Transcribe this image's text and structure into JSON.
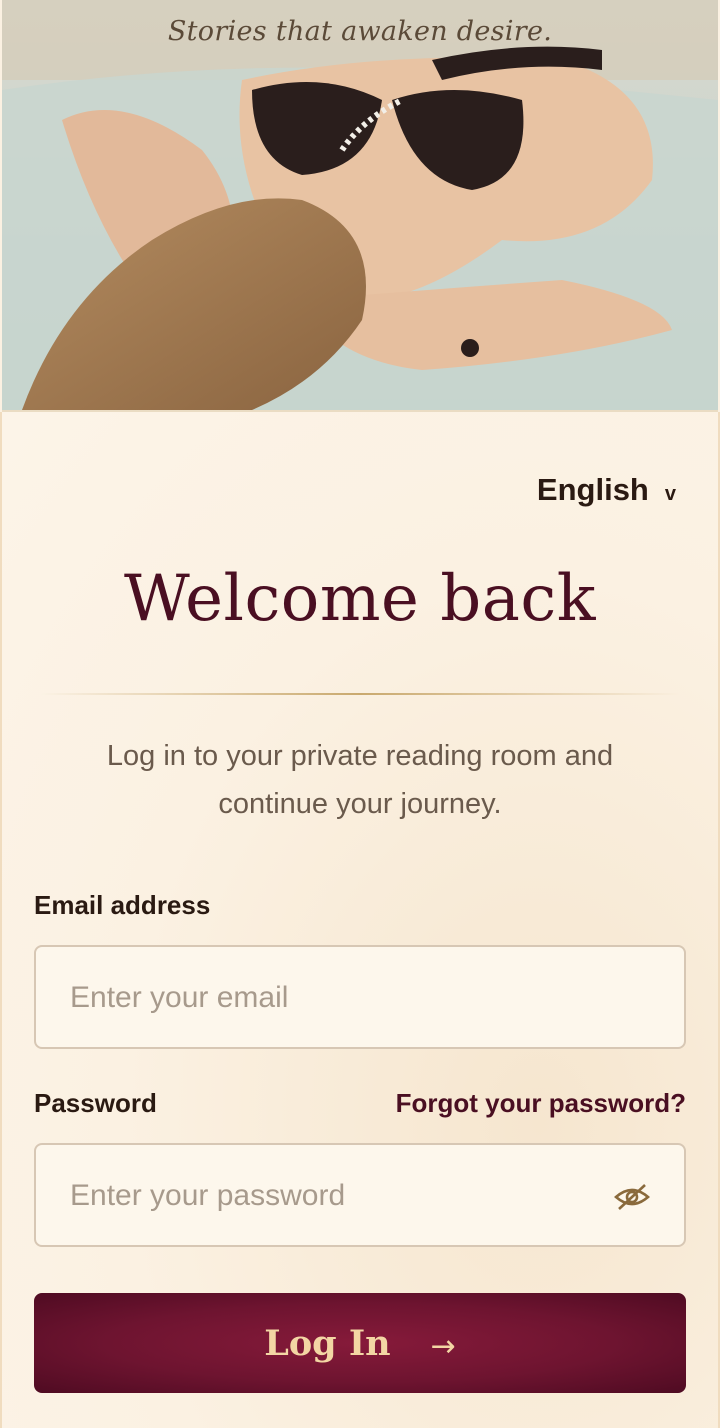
{
  "hero": {
    "tagline": "Stories that awaken desire."
  },
  "language": {
    "selected": "English",
    "chevron": "v"
  },
  "heading": "Welcome back",
  "subtitle": "Log in to your private reading room and continue your journey.",
  "email": {
    "label": "Email address",
    "placeholder": "Enter your email",
    "value": ""
  },
  "password": {
    "label": "Password",
    "placeholder": "Enter your password",
    "value": "",
    "toggle_icon": "eye-slash-icon"
  },
  "forgot_link": "Forgot your password?",
  "login_button": {
    "label": "Log In",
    "arrow": "→"
  },
  "colors": {
    "accent": "#4a0f22",
    "button": "#6e1430",
    "button_text": "#f3d6a4",
    "gold": "#c9a96e",
    "background": "#fbf1e2"
  }
}
